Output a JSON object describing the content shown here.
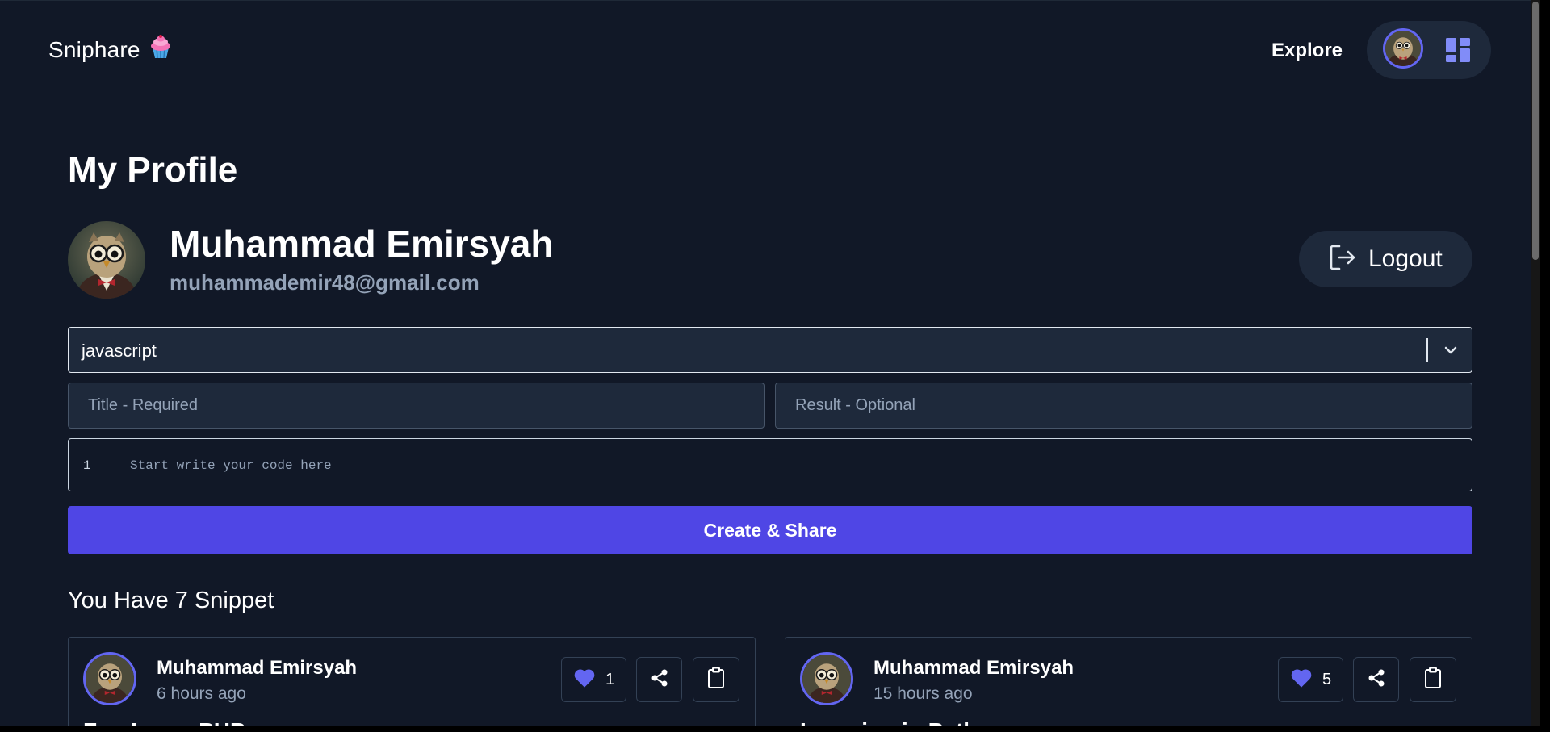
{
  "header": {
    "brand": "Sniphare",
    "brand_icon": "cupcake-icon",
    "nav_explore": "Explore",
    "dashboard_icon": "dashboard-grid-icon"
  },
  "profile": {
    "page_title": "My Profile",
    "name": "Muhammad Emirsyah",
    "email": "muhammademir48@gmail.com",
    "logout_label": "Logout"
  },
  "form": {
    "language_value": "javascript",
    "title_placeholder": "Title - Required",
    "result_placeholder": "Result - Optional",
    "code_line_number": "1",
    "code_placeholder": "Start write your code here",
    "submit_label": "Create & Share"
  },
  "snippets": {
    "heading": "You Have 7 Snippet",
    "cards": [
      {
        "author": "Muhammad Emirsyah",
        "time": "6 hours ago",
        "likes": "1",
        "title": "Fun Learn PHP"
      },
      {
        "author": "Muhammad Emirsyah",
        "time": "15 hours ago",
        "likes": "5",
        "title": "Learning in Python"
      }
    ]
  },
  "colors": {
    "background": "#111827",
    "surface": "#1e293b",
    "accent": "#4f46e5",
    "accent_light": "#6366f1",
    "muted_text": "#94a3b8"
  }
}
